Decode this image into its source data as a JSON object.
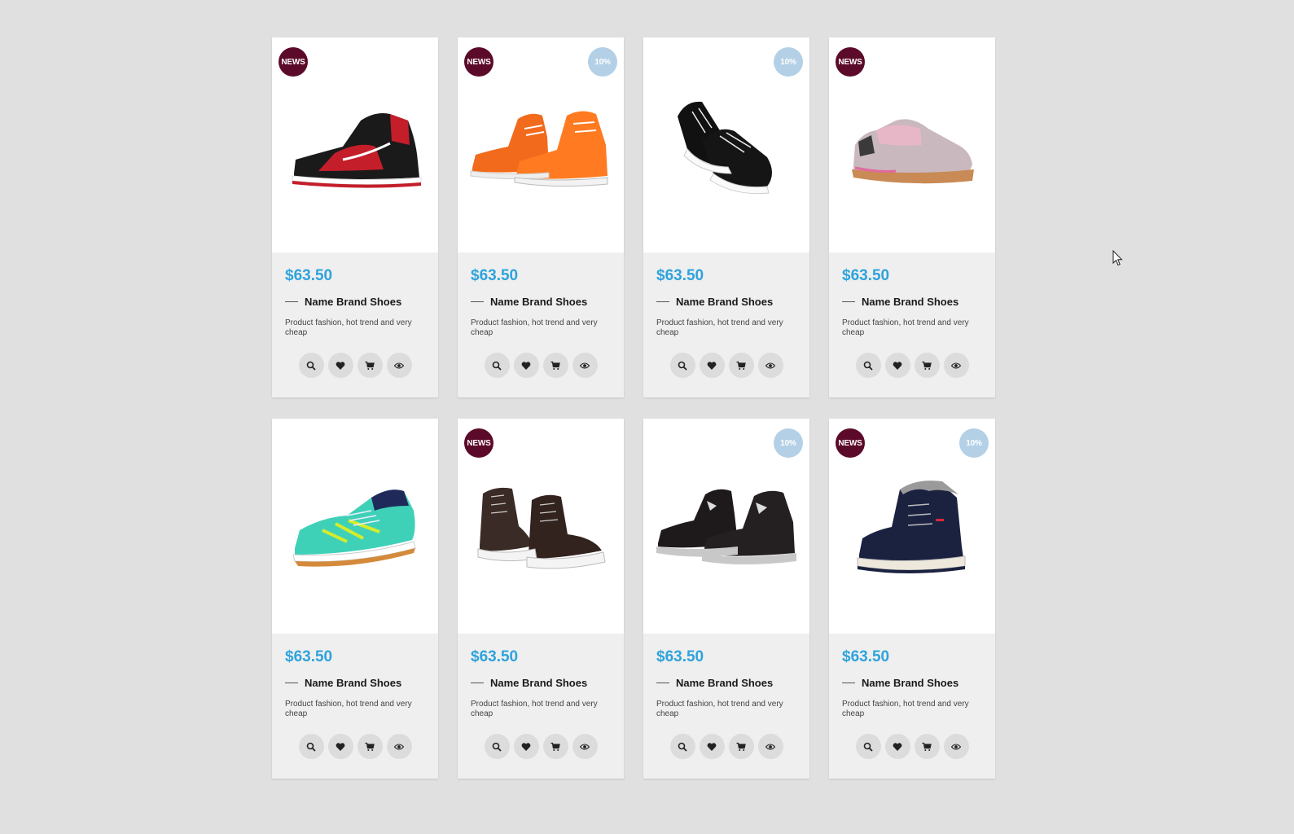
{
  "colors": {
    "background": "#e0e0e0",
    "card": "#ffffff",
    "card_body": "#efefef",
    "price": "#2ea3dc",
    "badge_news": "#5c0a2a",
    "badge_sale": "#b3d0e6",
    "action_button": "#dcdcdc"
  },
  "action_icons": [
    "search-icon",
    "heart-icon",
    "cart-icon",
    "eye-icon"
  ],
  "products": [
    {
      "price": "$63.50",
      "name": "Name Brand Shoes",
      "description": "Product fashion, hot trend and very cheap",
      "badge_news": "NEWS",
      "badge_sale": "",
      "image": "red-black-high-top-sneaker"
    },
    {
      "price": "$63.50",
      "name": "Name Brand Shoes",
      "description": "Product fashion, hot trend and very cheap",
      "badge_news": "NEWS",
      "badge_sale": "10%",
      "image": "orange-high-top-sneakers-pair"
    },
    {
      "price": "$63.50",
      "name": "Name Brand Shoes",
      "description": "Product fashion, hot trend and very cheap",
      "badge_news": "",
      "badge_sale": "10%",
      "image": "black-white-sneakers-pair"
    },
    {
      "price": "$63.50",
      "name": "Name Brand Shoes",
      "description": "Product fashion, hot trend and very cheap",
      "badge_news": "NEWS",
      "badge_sale": "",
      "image": "pink-grey-knit-sneaker"
    },
    {
      "price": "$63.50",
      "name": "Name Brand Shoes",
      "description": "Product fashion, hot trend and very cheap",
      "badge_news": "",
      "badge_sale": "",
      "image": "teal-running-shoe"
    },
    {
      "price": "$63.50",
      "name": "Name Brand Shoes",
      "description": "Product fashion, hot trend and very cheap",
      "badge_news": "NEWS",
      "badge_sale": "",
      "image": "brown-high-top-sneakers-pair"
    },
    {
      "price": "$63.50",
      "name": "Name Brand Shoes",
      "description": "Product fashion, hot trend and very cheap",
      "badge_news": "",
      "badge_sale": "10%",
      "image": "black-sneakers-pair"
    },
    {
      "price": "$63.50",
      "name": "Name Brand Shoes",
      "description": "Product fashion, hot trend and very cheap",
      "badge_news": "NEWS",
      "badge_sale": "10%",
      "image": "navy-fur-lined-boot"
    }
  ]
}
